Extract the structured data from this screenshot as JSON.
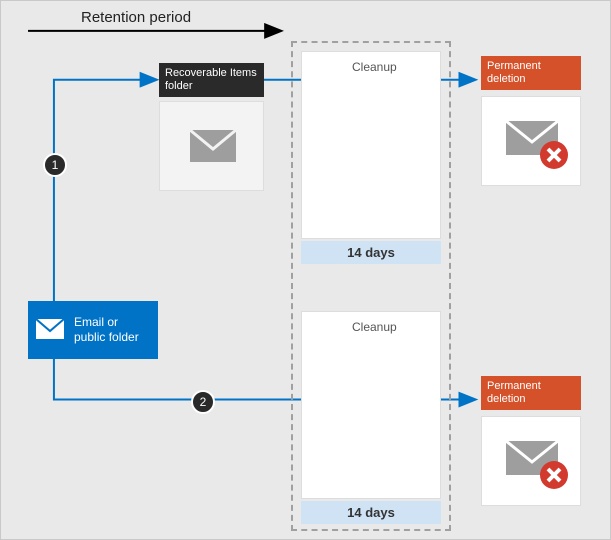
{
  "title": "Retention period",
  "source": {
    "label": "Email or public folder"
  },
  "recoverable": {
    "label": "Recoverable Items folder"
  },
  "cleanup1": {
    "label": "Cleanup",
    "days": "14 days"
  },
  "cleanup2": {
    "label": "Cleanup",
    "days": "14 days"
  },
  "perm1": {
    "label": "Permanent deletion"
  },
  "perm2": {
    "label": "Permanent deletion"
  },
  "steps": {
    "one": "1",
    "two": "2"
  }
}
